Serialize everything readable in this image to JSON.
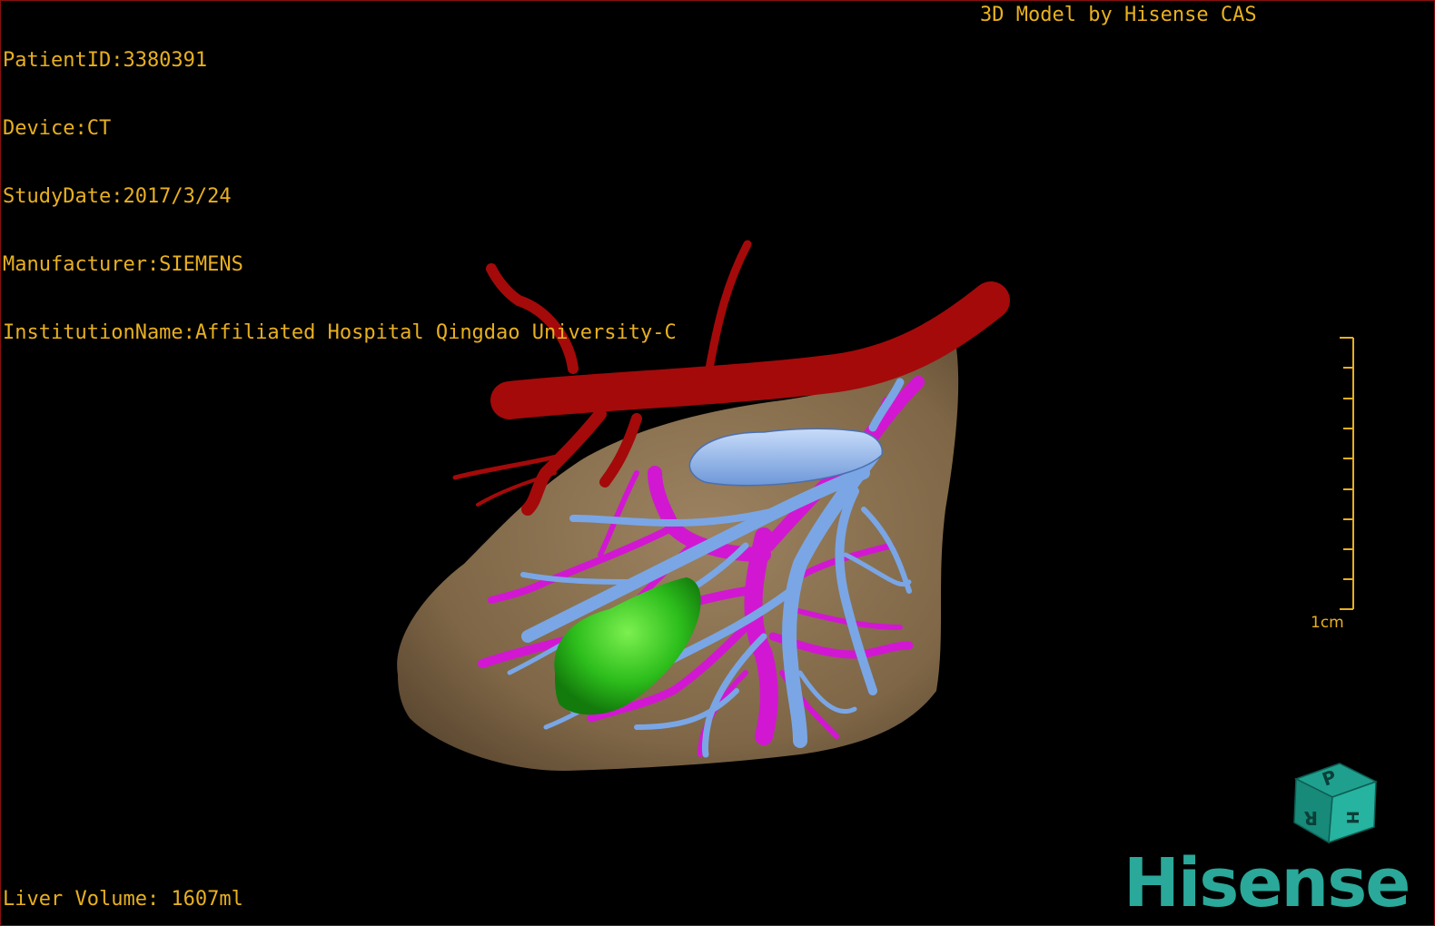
{
  "patient": {
    "id_line": "PatientID:3380391",
    "device_line": "Device:CT",
    "study_date_line": "StudyDate:2017/3/24",
    "manufacturer_line": "Manufacturer:SIEMENS",
    "institution_line": "InstitutionName:Affiliated Hospital Qingdao University-C"
  },
  "credit": "3D Model by Hisense CAS",
  "volume_line": "Liver Volume: 1607ml",
  "scale": {
    "label": "1cm"
  },
  "orientation_cube": {
    "face_top": "P",
    "face_left": "R",
    "face_right": "H"
  },
  "brand": "Hisense",
  "colors": {
    "overlay_text": "#e8b020",
    "liver": "#8c7251",
    "artery": "#a40a0a",
    "portal_vein": "#d217d2",
    "hepatic_vein": "#7aa6e6",
    "gallbladder": "#30c020",
    "brand": "#2aa89a"
  }
}
